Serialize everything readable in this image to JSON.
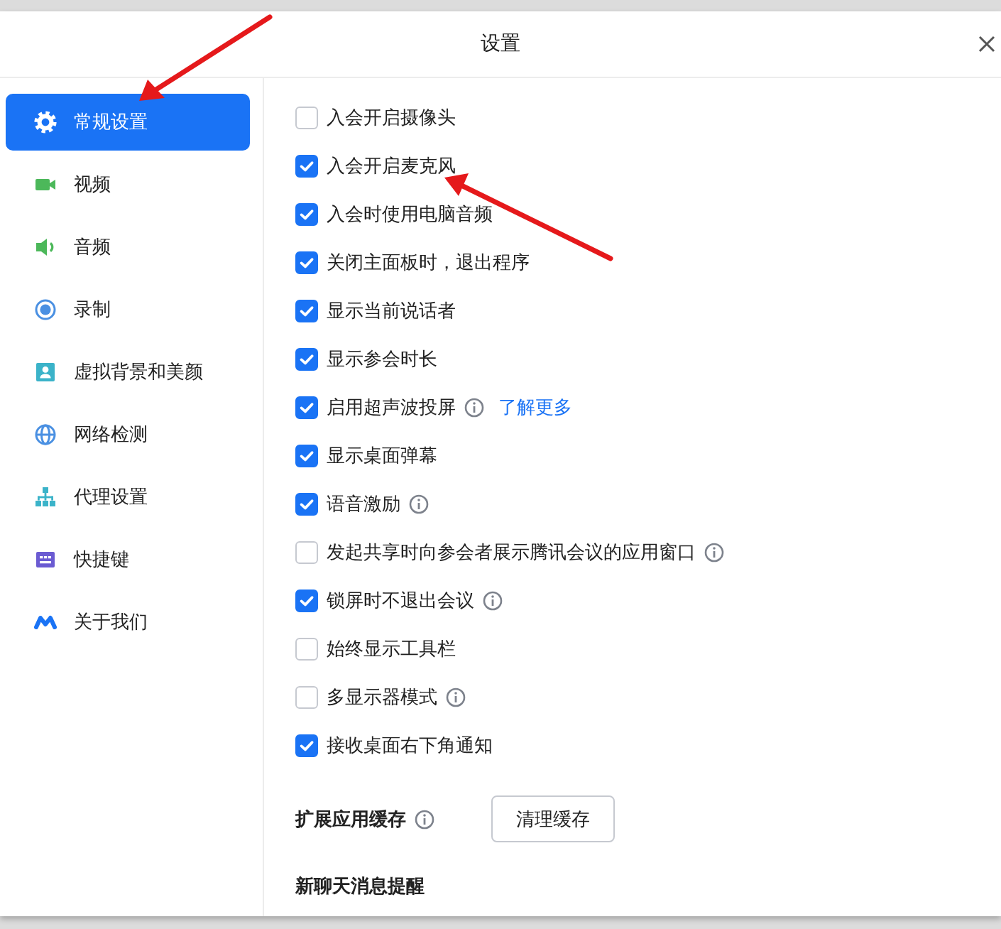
{
  "window": {
    "title": "设置"
  },
  "sidebar": {
    "items": [
      {
        "label": "常规设置",
        "kind": "gear",
        "selected": true
      },
      {
        "label": "视频",
        "kind": "video",
        "selected": false
      },
      {
        "label": "音频",
        "kind": "speaker",
        "selected": false
      },
      {
        "label": "录制",
        "kind": "record",
        "selected": false
      },
      {
        "label": "虚拟背景和美颜",
        "kind": "person",
        "selected": false
      },
      {
        "label": "网络检测",
        "kind": "globe",
        "selected": false
      },
      {
        "label": "代理设置",
        "kind": "network",
        "selected": false
      },
      {
        "label": "快捷键",
        "kind": "keyboard",
        "selected": false
      },
      {
        "label": "关于我们",
        "kind": "wave",
        "selected": false
      }
    ]
  },
  "options": [
    {
      "label": "入会开启摄像头",
      "checked": false,
      "info": false
    },
    {
      "label": "入会开启麦克风",
      "checked": true,
      "info": false
    },
    {
      "label": "入会时使用电脑音频",
      "checked": true,
      "info": false
    },
    {
      "label": "关闭主面板时，退出程序",
      "checked": true,
      "info": false
    },
    {
      "label": "显示当前说话者",
      "checked": true,
      "info": false
    },
    {
      "label": "显示参会时长",
      "checked": true,
      "info": false
    },
    {
      "label": "启用超声波投屏",
      "checked": true,
      "info": true,
      "link": "了解更多"
    },
    {
      "label": "显示桌面弹幕",
      "checked": true,
      "info": false
    },
    {
      "label": "语音激励",
      "checked": true,
      "info": true
    },
    {
      "label": "发起共享时向参会者展示腾讯会议的应用窗口",
      "checked": false,
      "info": true
    },
    {
      "label": "锁屏时不退出会议",
      "checked": true,
      "info": true
    },
    {
      "label": "始终显示工具栏",
      "checked": false,
      "info": false
    },
    {
      "label": "多显示器模式",
      "checked": false,
      "info": true
    },
    {
      "label": "接收桌面右下角通知",
      "checked": true,
      "info": false
    }
  ],
  "cache": {
    "label": "扩展应用缓存",
    "info": true,
    "button": "清理缓存"
  },
  "section": {
    "title": "新聊天消息提醒"
  }
}
